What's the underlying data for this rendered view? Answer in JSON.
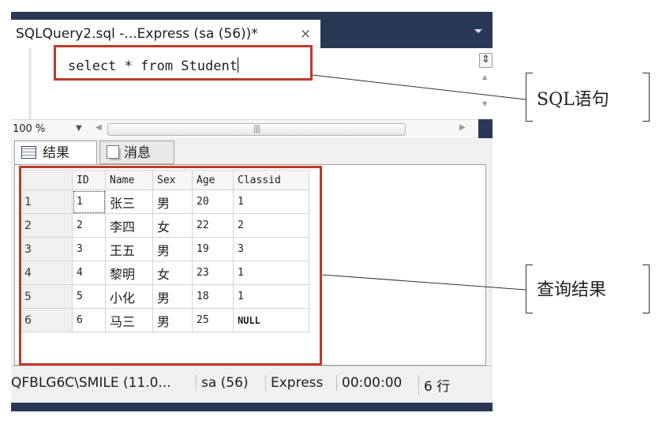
{
  "editor_tab": {
    "title": "SQLQuery2.sql -...Express (sa (56))*",
    "close": "×"
  },
  "editor": {
    "query": "select * from Student"
  },
  "zoom": {
    "level": "100 %"
  },
  "results_tabs": [
    {
      "label": "结果"
    },
    {
      "label": "消息"
    }
  ],
  "grid": {
    "columns": [
      "ID",
      "Name",
      "Sex",
      "Age",
      "Classid"
    ],
    "rows": [
      {
        "num": "1",
        "cells": [
          "1",
          "张三",
          "男",
          "20",
          "1"
        ]
      },
      {
        "num": "2",
        "cells": [
          "2",
          "李四",
          "女",
          "22",
          "2"
        ]
      },
      {
        "num": "3",
        "cells": [
          "3",
          "王五",
          "男",
          "19",
          "3"
        ]
      },
      {
        "num": "4",
        "cells": [
          "4",
          "黎明",
          "女",
          "23",
          "1"
        ]
      },
      {
        "num": "5",
        "cells": [
          "5",
          "小化",
          "男",
          "18",
          "1"
        ]
      },
      {
        "num": "6",
        "cells": [
          "6",
          "马三",
          "男",
          "25",
          "NULL"
        ]
      }
    ]
  },
  "status_bar": {
    "server": "QFBLG6C\\SMILE (11.0...",
    "user": "sa (56)",
    "database": "Express",
    "elapsed": "00:00:00",
    "row_count": "6 行"
  },
  "callouts": {
    "sql_label": "SQL语句",
    "result_label": "查询结果"
  },
  "colors": {
    "chrome": "#293955",
    "highlight": "#c0392b"
  }
}
